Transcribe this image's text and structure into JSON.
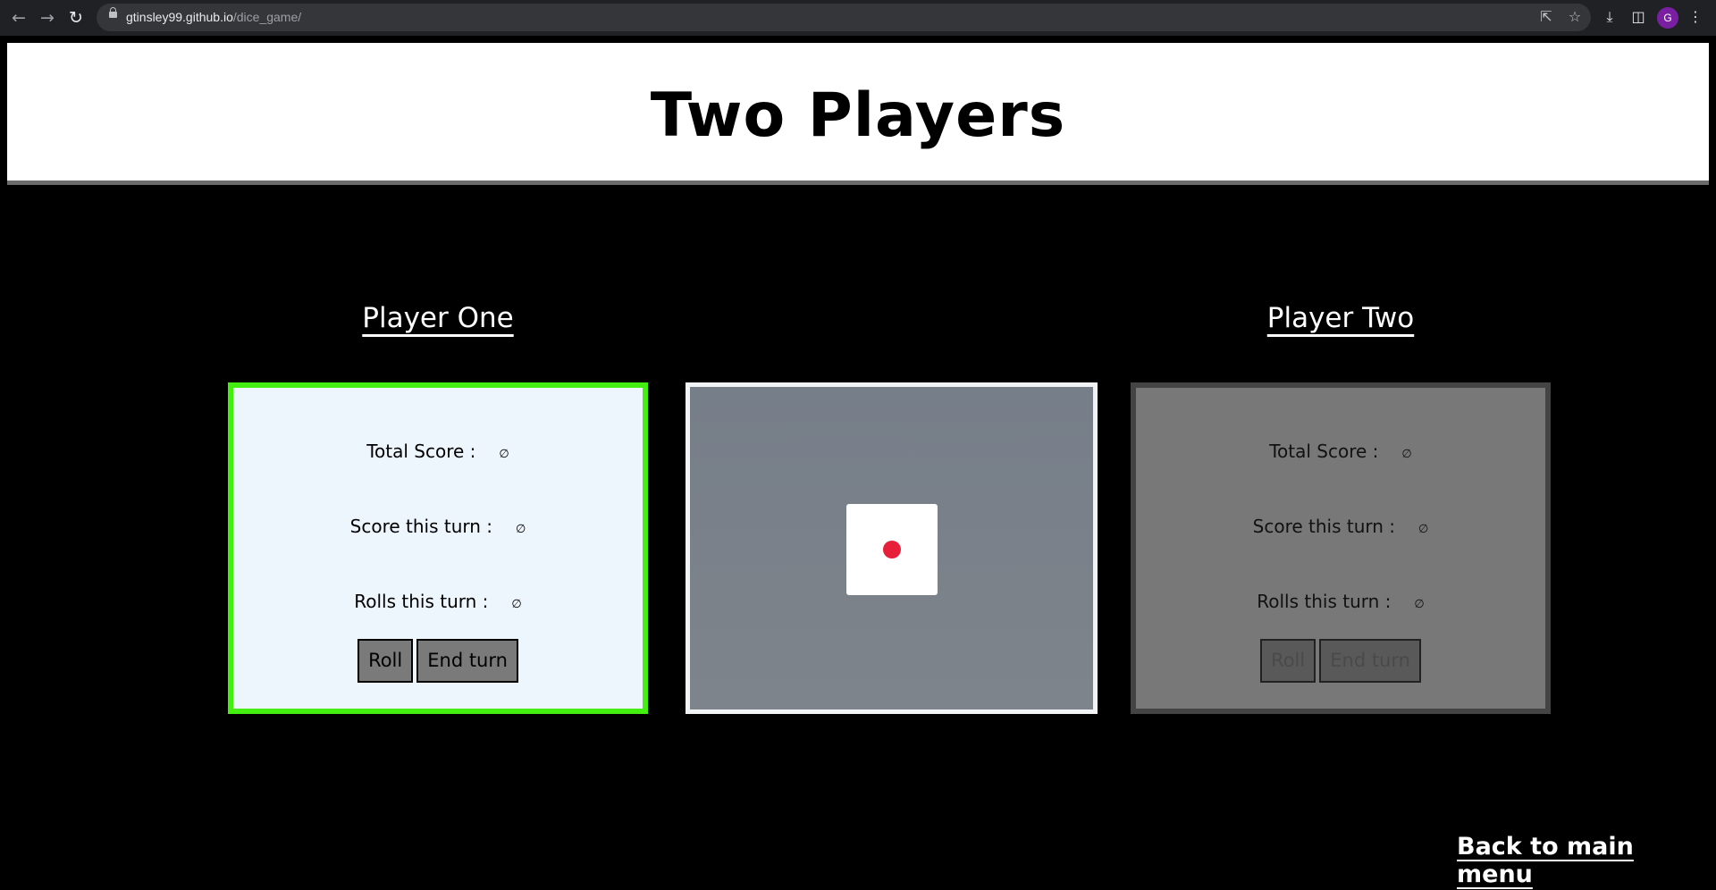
{
  "browser": {
    "url_host": "gtinsley99.github.io",
    "url_path": "/dice_game/",
    "profile_initial": "G",
    "icons": {
      "back": "back-arrow-icon",
      "forward": "forward-arrow-icon",
      "reload": "reload-icon",
      "share": "share-icon",
      "bookmark": "star-icon",
      "download": "download-icon",
      "side_panel": "side-panel-icon",
      "menu": "kebab-menu-icon"
    }
  },
  "page": {
    "title": "Two Players",
    "back_link": "Back to main menu"
  },
  "players": [
    {
      "heading": "Player One",
      "total_label": "Total Score :",
      "total_value": "0",
      "turn_label": "Score this turn :",
      "turn_value": "0",
      "rolls_label": "Rolls this turn :",
      "rolls_value": "0",
      "roll_button": "Roll",
      "end_button": "End turn",
      "active": true,
      "border_color": "#44ee11"
    },
    {
      "heading": "Player Two",
      "total_label": "Total Score :",
      "total_value": "0",
      "turn_label": "Score this turn :",
      "turn_value": "0",
      "rolls_label": "Rolls this turn :",
      "rolls_value": "0",
      "roll_button": "Roll",
      "end_button": "End turn",
      "active": false,
      "border_color": "#444444"
    }
  ],
  "dice": {
    "face_value": 1,
    "pip_color": "#e81f3a"
  }
}
